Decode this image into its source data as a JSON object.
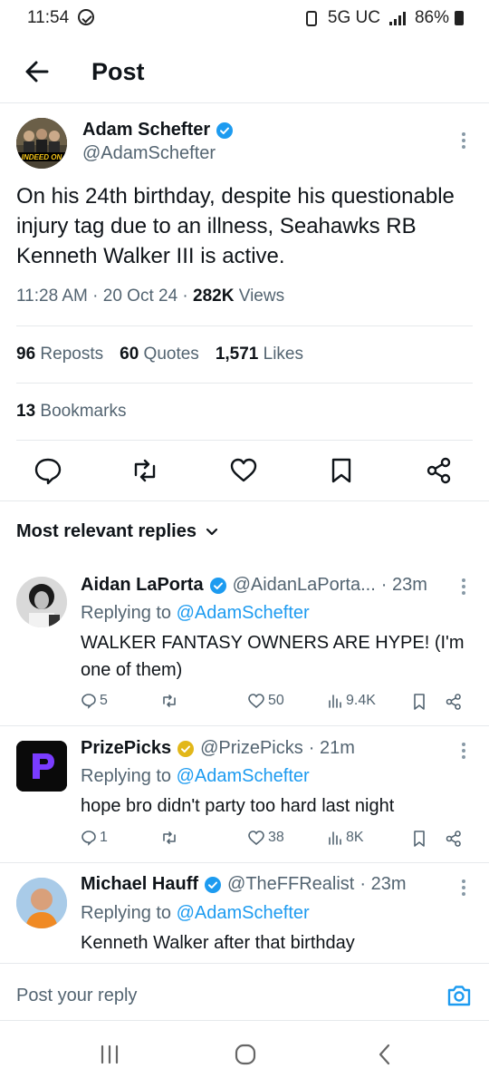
{
  "status_bar": {
    "time": "11:54",
    "network": "5G UC",
    "battery": "86%"
  },
  "header": {
    "title": "Post"
  },
  "tweet": {
    "author_name": "Adam Schefter",
    "author_handle": "@AdamSchefter",
    "avatar_caption": "INDEED ON",
    "text": "On his 24th birthday, despite his questionable injury tag due to an illness, Seahawks RB Kenneth Walker III is active.",
    "time": "11:28 AM",
    "date": "20 Oct 24",
    "views_count": "282K",
    "views_label": "Views",
    "reposts_count": "96",
    "reposts_label": "Reposts",
    "quotes_count": "60",
    "quotes_label": "Quotes",
    "likes_count": "1,571",
    "likes_label": "Likes",
    "bookmarks_count": "13",
    "bookmarks_label": "Bookmarks"
  },
  "replies_filter": {
    "label": "Most relevant replies"
  },
  "replies": [
    {
      "name": "Aidan LaPorta",
      "handle": "@AidanLaPorta...",
      "time": "· 23m",
      "replying_prefix": "Replying to",
      "replying_to": "@AdamSchefter",
      "text": "WALKER FANTASY OWNERS ARE HYPE! (I'm one of them)",
      "comments": "5",
      "likes": "50",
      "views": "9.4K",
      "badge_color": "#1d9bf0"
    },
    {
      "name": "PrizePicks",
      "handle": "@PrizePicks",
      "time": "· 21m",
      "replying_prefix": "Replying to",
      "replying_to": "@AdamSchefter",
      "text": "hope bro didn't party too hard last night",
      "comments": "1",
      "likes": "38",
      "views": "8K",
      "badge_color": "#e2b719"
    },
    {
      "name": "Michael Hauff",
      "handle": "@TheFFRealist",
      "time": "· 23m",
      "replying_prefix": "Replying to",
      "replying_to": "@AdamSchefter",
      "text": "Kenneth Walker after that birthday",
      "badge_color": "#1d9bf0"
    }
  ],
  "compose": {
    "placeholder": "Post your reply"
  },
  "colors": {
    "accent": "#1d9bf0",
    "secondary_text": "#536471",
    "divider": "#e6e9ec"
  }
}
